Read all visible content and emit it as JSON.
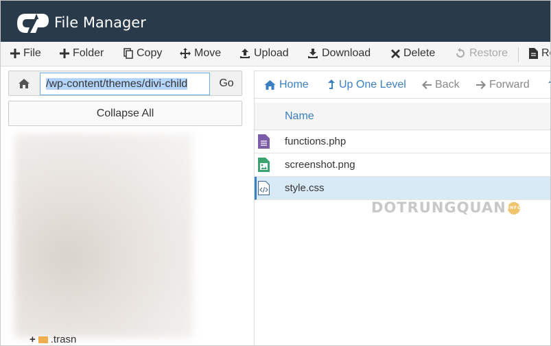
{
  "header": {
    "app_title": "File Manager",
    "brand_color": "#293a4a"
  },
  "toolbar": {
    "items": [
      {
        "label": "File",
        "icon": "plus-icon"
      },
      {
        "label": "Folder",
        "icon": "plus-icon"
      },
      {
        "label": "Copy",
        "icon": "copy-icon"
      },
      {
        "label": "Move",
        "icon": "move-arrows-icon"
      },
      {
        "label": "Upload",
        "icon": "upload-icon"
      },
      {
        "label": "Download",
        "icon": "download-icon"
      },
      {
        "label": "Delete",
        "icon": "x-icon"
      },
      {
        "label": "Restore",
        "icon": "restore-icon",
        "disabled": true
      },
      {
        "label": "Re",
        "icon": "document-icon"
      }
    ]
  },
  "left_panel": {
    "path_value": "/wp-content/themes/divi-child",
    "go_label": "Go",
    "collapse_label": "Collapse All",
    "tree": [
      {
        "label": ".trasn",
        "expand": "+"
      }
    ]
  },
  "right_panel": {
    "nav": [
      {
        "label": "Home",
        "icon": "home-icon"
      },
      {
        "label": "Up One Level",
        "icon": "level-up-icon"
      },
      {
        "label": "Back",
        "icon": "arrow-left-icon",
        "disabled": true
      },
      {
        "label": "Forward",
        "icon": "arrow-right-icon",
        "disabled": true
      }
    ],
    "columns": [
      "Name"
    ],
    "files": [
      {
        "name": "functions.php",
        "icon": "text-file-icon",
        "icon_color": "#7b5ea7"
      },
      {
        "name": "screenshot.png",
        "icon": "image-file-icon",
        "icon_color": "#3aa36f"
      },
      {
        "name": "style.css",
        "icon": "code-file-icon",
        "icon_color": "#4a6c8c",
        "selected": true
      }
    ]
  },
  "watermark": {
    "text": "DOTRUNGQUAN",
    "badge": "INFO"
  },
  "colors": {
    "link": "#3a7fc1",
    "selected_row": "#d9eaf7"
  }
}
